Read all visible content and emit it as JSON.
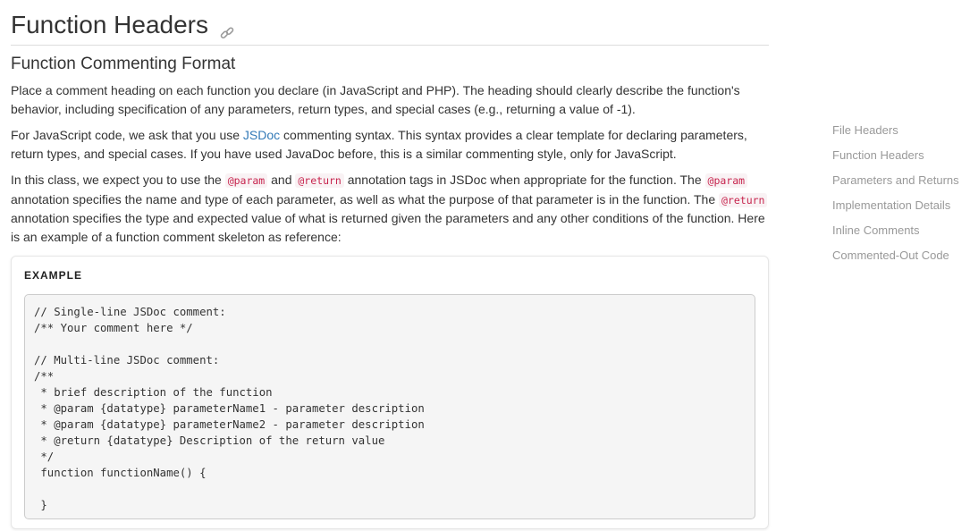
{
  "page": {
    "title": "Function Headers",
    "link_icon": "link-icon"
  },
  "section": {
    "subtitle": "Function Commenting Format",
    "para1": "Place a comment heading on each function you declare (in JavaScript and PHP). The heading should clearly describe the function's behavior, including specification of any parameters, return types, and special cases (e.g., returning a value of -1).",
    "para2": {
      "before": "For JavaScript code, we ask that you use ",
      "link": "JSDoc",
      "after": " commenting syntax. This syntax provides a clear template for declaring parameters, return types, and special cases. If you have used JavaDoc before, this is a similar commenting style, only for JavaScript."
    },
    "para3": {
      "t1": "In this class, we expect you to use the ",
      "c1": "@param",
      "t2": " and ",
      "c2": "@return",
      "t3": " annotation tags in JSDoc when appropriate for the function. The ",
      "c3": "@param",
      "t4": " annotation specifies the name and type of each parameter, as well as what the purpose of that parameter is in the function. The ",
      "c4": "@return",
      "t5": " annotation specifies the type and expected value of what is returned given the parameters and any other conditions of the function. Here is an example of a function comment skeleton as reference:"
    }
  },
  "example": {
    "label": "EXAMPLE",
    "code": "// Single-line JSDoc comment:\n/** Your comment here */\n\n// Multi-line JSDoc comment:\n/**\n * brief description of the function\n * @param {datatype} parameterName1 - parameter description\n * @param {datatype} parameterName2 - parameter description\n * @return {datatype} Description of the return value\n */\n function functionName() {\n\n }"
  },
  "toc": {
    "items": [
      "File Headers",
      "Function Headers",
      "Parameters and Returns",
      "Implementation Details",
      "Inline Comments",
      "Commented-Out Code"
    ]
  }
}
